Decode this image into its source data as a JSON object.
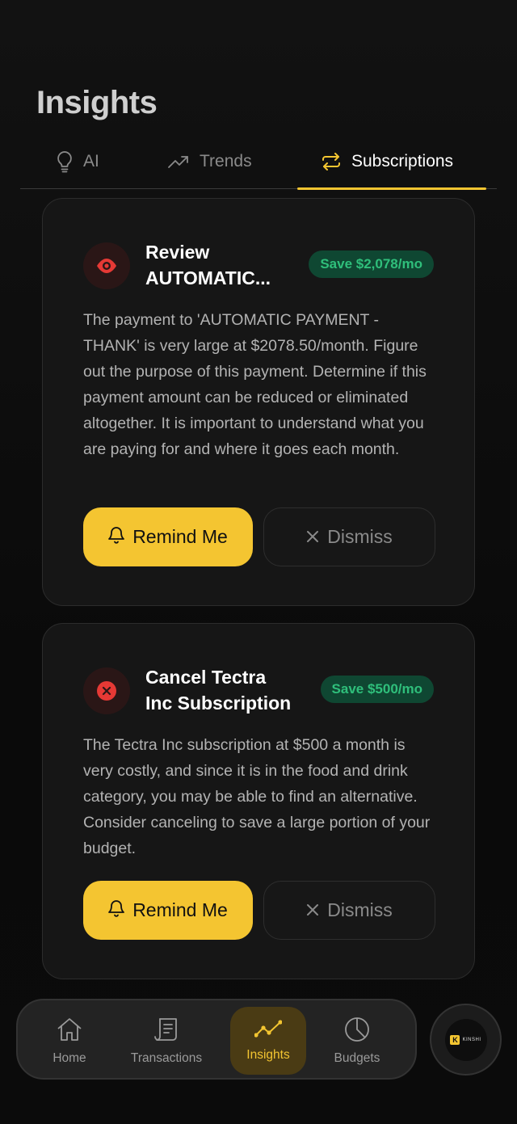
{
  "header": {
    "title": "Insights"
  },
  "tabs": [
    {
      "label": "AI",
      "icon": "lightbulb-icon"
    },
    {
      "label": "Trends",
      "icon": "trending-up-icon"
    },
    {
      "label": "Subscriptions",
      "icon": "repeat-icon",
      "active": true
    }
  ],
  "cards": [
    {
      "icon": "eye-icon",
      "title": "Review AUTOMATIC...",
      "badge": "Save $2,078/mo",
      "body": "The payment to 'AUTOMATIC PAYMENT - THANK' is very large at $2078.50/month. Figure out the purpose of this payment. Determine if this payment amount can be reduced or eliminated altogether. It is important to understand what you are paying for and where it goes each month.",
      "remind_label": "Remind Me",
      "dismiss_label": "Dismiss"
    },
    {
      "icon": "close-circle-icon",
      "title": "Cancel Tectra Inc Subscription",
      "badge": "Save $500/mo",
      "body": "The Tectra Inc subscription at $500 a month is very costly, and since it is in the food and drink category, you may be able to find an alternative. Consider canceling to save a large portion of your budget.",
      "remind_label": "Remind Me",
      "dismiss_label": "Dismiss"
    }
  ],
  "nav": {
    "items": [
      {
        "label": "Home",
        "icon": "home-icon"
      },
      {
        "label": "Transactions",
        "icon": "receipt-icon"
      },
      {
        "label": "Insights",
        "icon": "chart-line-icon",
        "active": true
      },
      {
        "label": "Budgets",
        "icon": "pie-chart-icon"
      }
    ]
  },
  "fab": {
    "logo_letter": "K",
    "logo_text": "KINSHI"
  },
  "colors": {
    "accent": "#f4c531",
    "badge_bg": "#0f4732",
    "badge_text": "#2fbf7b",
    "danger": "#e53935"
  }
}
